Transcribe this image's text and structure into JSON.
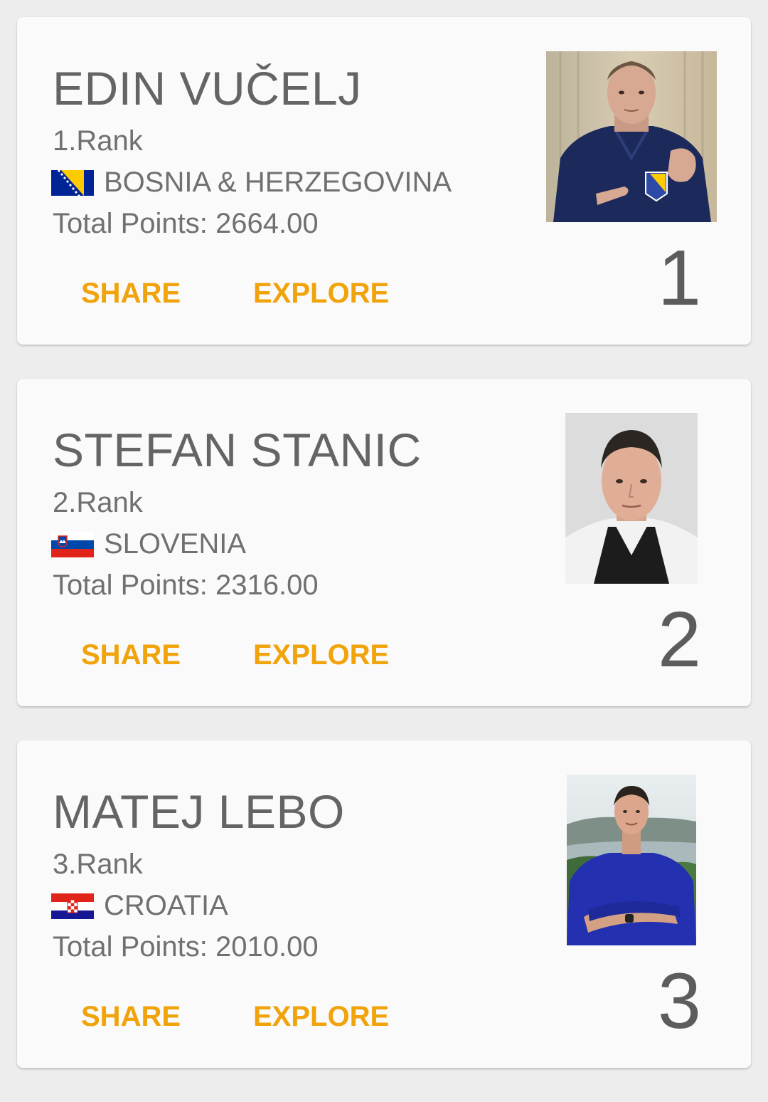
{
  "athletes": [
    {
      "name": "EDIN VUČELJ",
      "rank_label": "1.Rank",
      "country": "BOSNIA & HERZEGOVINA",
      "flag": "bosnia-flag",
      "points": "Total Points: 2664.00",
      "rank_number": "1",
      "photo": "athlete-photo-edin"
    },
    {
      "name": "STEFAN STANIC",
      "rank_label": "2.Rank",
      "country": "SLOVENIA",
      "flag": "slovenia-flag",
      "points": "Total Points: 2316.00",
      "rank_number": "2",
      "photo": "athlete-photo-stefan"
    },
    {
      "name": "MATEJ LEBO",
      "rank_label": "3.Rank",
      "country": "CROATIA",
      "flag": "croatia-flag",
      "points": "Total Points: 2010.00",
      "rank_number": "3",
      "photo": "athlete-photo-matej"
    }
  ],
  "actions": {
    "share_label": "SHARE",
    "explore_label": "EXPLORE"
  },
  "colors": {
    "accent": "#f0a30a",
    "text": "#707070",
    "card": "#fafafa",
    "background": "#ededed"
  }
}
